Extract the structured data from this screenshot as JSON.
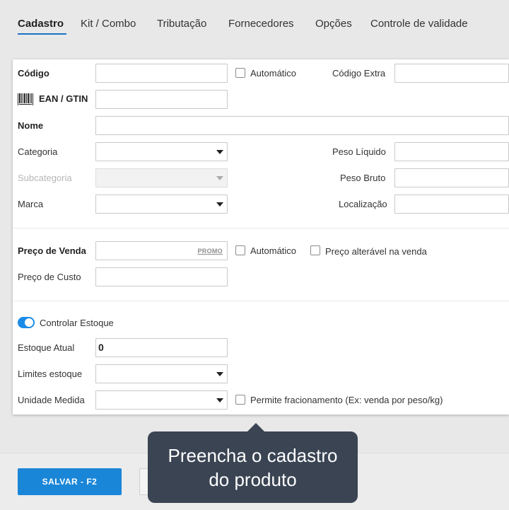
{
  "tabs": [
    {
      "label": "Cadastro",
      "active": true
    },
    {
      "label": "Kit / Combo"
    },
    {
      "label": "Tributação"
    },
    {
      "label": "Fornecedores"
    },
    {
      "label": "Opções"
    },
    {
      "label": "Controle de validade"
    }
  ],
  "form": {
    "codigo_label": "Código",
    "codigo_value": "",
    "automatico_label": "Automático",
    "codigo_extra_label": "Código Extra",
    "ean_label": "EAN / GTIN",
    "nome_label": "Nome",
    "categoria_label": "Categoria",
    "subcategoria_label": "Subcategoria",
    "marca_label": "Marca",
    "peso_liquido_label": "Peso Líquido",
    "peso_bruto_label": "Peso Bruto",
    "localizacao_label": "Localização",
    "preco_venda_label": "Preço de Venda",
    "promo_label": "PROMO",
    "preco_automatico_label": "Automático",
    "preco_alteravel_label": "Preço alterável na venda",
    "preco_custo_label": "Preço de Custo",
    "controlar_estoque_label": "Controlar Estoque",
    "controlar_estoque_on": true,
    "estoque_atual_label": "Estoque Atual",
    "estoque_atual_value": "0",
    "limites_estoque_label": "Limites estoque",
    "unidade_medida_label": "Unidade Medida",
    "fracionamento_label": "Permite fracionamento (Ex: venda por peso/kg)"
  },
  "footer": {
    "save_label": "SALVAR - F2"
  },
  "tooltip": {
    "line1": "Preencha o cadastro",
    "line2": "do produto"
  },
  "colors": {
    "accent": "#1a86d8",
    "toggle": "#1a8ce8",
    "tooltip_bg": "#3a4453",
    "page_bg": "#e8e8e8"
  },
  "icons": [
    "barcode-icon",
    "dropdown-caret-icon",
    "toggle-switch"
  ]
}
